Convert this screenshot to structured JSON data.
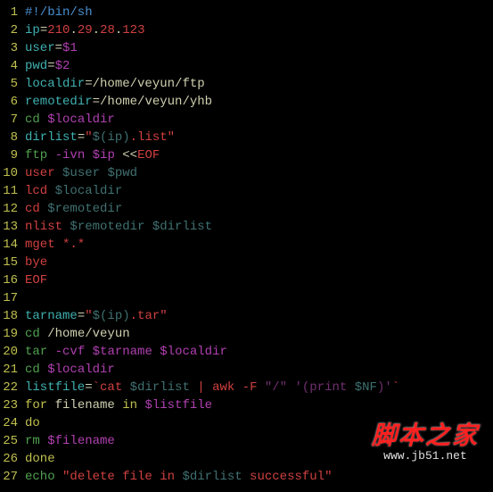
{
  "lines": [
    {
      "n": "1",
      "tokens": [
        {
          "t": "#!/bin/sh",
          "c": "c-comment"
        }
      ]
    },
    {
      "n": "2",
      "tokens": [
        {
          "t": "ip",
          "c": "c-cyan"
        },
        {
          "t": "=",
          "c": "c-white"
        },
        {
          "t": "210",
          "c": "c-red"
        },
        {
          "t": ".",
          "c": "c-white"
        },
        {
          "t": "29",
          "c": "c-red"
        },
        {
          "t": ".",
          "c": "c-white"
        },
        {
          "t": "28",
          "c": "c-red"
        },
        {
          "t": ".",
          "c": "c-white"
        },
        {
          "t": "123",
          "c": "c-red"
        }
      ]
    },
    {
      "n": "3",
      "tokens": [
        {
          "t": "user",
          "c": "c-cyan"
        },
        {
          "t": "=",
          "c": "c-white"
        },
        {
          "t": "$1",
          "c": "c-magenta"
        }
      ]
    },
    {
      "n": "4",
      "tokens": [
        {
          "t": "pwd",
          "c": "c-cyan"
        },
        {
          "t": "=",
          "c": "c-white"
        },
        {
          "t": "$2",
          "c": "c-magenta"
        }
      ]
    },
    {
      "n": "5",
      "tokens": [
        {
          "t": "localdir",
          "c": "c-cyan"
        },
        {
          "t": "=",
          "c": "c-white"
        },
        {
          "t": "/home/veyun/ftp",
          "c": "c-white"
        }
      ]
    },
    {
      "n": "6",
      "tokens": [
        {
          "t": "remotedir",
          "c": "c-cyan"
        },
        {
          "t": "=",
          "c": "c-white"
        },
        {
          "t": "/home/veyun/yhb",
          "c": "c-white"
        }
      ]
    },
    {
      "n": "7",
      "tokens": [
        {
          "t": "cd",
          "c": "c-green"
        },
        {
          "t": " ",
          "c": "c-white"
        },
        {
          "t": "$localdir",
          "c": "c-magenta"
        }
      ]
    },
    {
      "n": "8",
      "tokens": [
        {
          "t": "dirlist",
          "c": "c-cyan"
        },
        {
          "t": "=",
          "c": "c-white"
        },
        {
          "t": "\"",
          "c": "c-red"
        },
        {
          "t": "$(ip)",
          "c": "c-darkcyan"
        },
        {
          "t": ".list",
          "c": "c-red"
        },
        {
          "t": "\"",
          "c": "c-red"
        }
      ]
    },
    {
      "n": "9",
      "tokens": [
        {
          "t": "ftp",
          "c": "c-green"
        },
        {
          "t": " ",
          "c": "c-white"
        },
        {
          "t": "-ivn",
          "c": "c-magenta"
        },
        {
          "t": " ",
          "c": "c-white"
        },
        {
          "t": "$ip",
          "c": "c-magenta"
        },
        {
          "t": " <<",
          "c": "c-white"
        },
        {
          "t": "EOF",
          "c": "c-red"
        }
      ]
    },
    {
      "n": "10",
      "tokens": [
        {
          "t": "user ",
          "c": "c-red"
        },
        {
          "t": "$user",
          "c": "c-darkcyan"
        },
        {
          "t": " ",
          "c": "c-red"
        },
        {
          "t": "$pwd",
          "c": "c-darkcyan"
        }
      ]
    },
    {
      "n": "11",
      "tokens": [
        {
          "t": "lcd ",
          "c": "c-red"
        },
        {
          "t": "$localdir",
          "c": "c-darkcyan"
        }
      ]
    },
    {
      "n": "12",
      "tokens": [
        {
          "t": "cd ",
          "c": "c-red"
        },
        {
          "t": "$remotedir",
          "c": "c-darkcyan"
        }
      ]
    },
    {
      "n": "13",
      "tokens": [
        {
          "t": "nlist ",
          "c": "c-red"
        },
        {
          "t": "$remotedir",
          "c": "c-darkcyan"
        },
        {
          "t": " ",
          "c": "c-red"
        },
        {
          "t": "$dirlist",
          "c": "c-darkcyan"
        }
      ]
    },
    {
      "n": "14",
      "tokens": [
        {
          "t": "mget *.*",
          "c": "c-red"
        }
      ]
    },
    {
      "n": "15",
      "tokens": [
        {
          "t": "bye",
          "c": "c-red"
        }
      ]
    },
    {
      "n": "16",
      "tokens": [
        {
          "t": "EOF",
          "c": "c-red"
        }
      ]
    },
    {
      "n": "17",
      "tokens": [
        {
          "t": "",
          "c": "c-white"
        }
      ]
    },
    {
      "n": "18",
      "tokens": [
        {
          "t": "tarname",
          "c": "c-cyan"
        },
        {
          "t": "=",
          "c": "c-white"
        },
        {
          "t": "\"",
          "c": "c-red"
        },
        {
          "t": "$(ip)",
          "c": "c-darkcyan"
        },
        {
          "t": ".tar",
          "c": "c-red"
        },
        {
          "t": "\"",
          "c": "c-red"
        }
      ]
    },
    {
      "n": "19",
      "tokens": [
        {
          "t": "cd",
          "c": "c-green"
        },
        {
          "t": " /home/veyun",
          "c": "c-white"
        }
      ]
    },
    {
      "n": "20",
      "tokens": [
        {
          "t": "tar",
          "c": "c-green"
        },
        {
          "t": " ",
          "c": "c-white"
        },
        {
          "t": "-cvf",
          "c": "c-magenta"
        },
        {
          "t": " ",
          "c": "c-white"
        },
        {
          "t": "$tarname",
          "c": "c-magenta"
        },
        {
          "t": " ",
          "c": "c-white"
        },
        {
          "t": "$localdir",
          "c": "c-magenta"
        }
      ]
    },
    {
      "n": "21",
      "tokens": [
        {
          "t": "cd",
          "c": "c-green"
        },
        {
          "t": " ",
          "c": "c-white"
        },
        {
          "t": "$localdir",
          "c": "c-magenta"
        }
      ]
    },
    {
      "n": "22",
      "tokens": [
        {
          "t": "listfile",
          "c": "c-cyan"
        },
        {
          "t": "=",
          "c": "c-white"
        },
        {
          "t": "`",
          "c": "c-red"
        },
        {
          "t": "cat ",
          "c": "c-red"
        },
        {
          "t": "$dirlist",
          "c": "c-darkcyan"
        },
        {
          "t": " | awk -F ",
          "c": "c-red"
        },
        {
          "t": "\"/\"",
          "c": "c-darkmagenta"
        },
        {
          "t": " ",
          "c": "c-red"
        },
        {
          "t": "'(print ",
          "c": "c-darkmagenta"
        },
        {
          "t": "$NF",
          "c": "c-darkcyan"
        },
        {
          "t": ")'",
          "c": "c-darkmagenta"
        },
        {
          "t": "`",
          "c": "c-red"
        }
      ]
    },
    {
      "n": "23",
      "tokens": [
        {
          "t": "for",
          "c": "c-yellow"
        },
        {
          "t": " filename ",
          "c": "c-white"
        },
        {
          "t": "in",
          "c": "c-yellow"
        },
        {
          "t": " ",
          "c": "c-white"
        },
        {
          "t": "$listfile",
          "c": "c-magenta"
        }
      ]
    },
    {
      "n": "24",
      "tokens": [
        {
          "t": "do",
          "c": "c-yellow"
        }
      ]
    },
    {
      "n": "25",
      "tokens": [
        {
          "t": "rm",
          "c": "c-green"
        },
        {
          "t": " ",
          "c": "c-white"
        },
        {
          "t": "$filename",
          "c": "c-magenta"
        }
      ]
    },
    {
      "n": "26",
      "tokens": [
        {
          "t": "done",
          "c": "c-yellow"
        }
      ]
    },
    {
      "n": "27",
      "tokens": [
        {
          "t": "echo",
          "c": "c-green"
        },
        {
          "t": " ",
          "c": "c-white"
        },
        {
          "t": "\"delete file in ",
          "c": "c-red"
        },
        {
          "t": "$dirlist",
          "c": "c-darkcyan"
        },
        {
          "t": " successful\"",
          "c": "c-red"
        }
      ]
    }
  ],
  "watermark": {
    "title": "脚本之家",
    "url": "www.jb51.net"
  }
}
